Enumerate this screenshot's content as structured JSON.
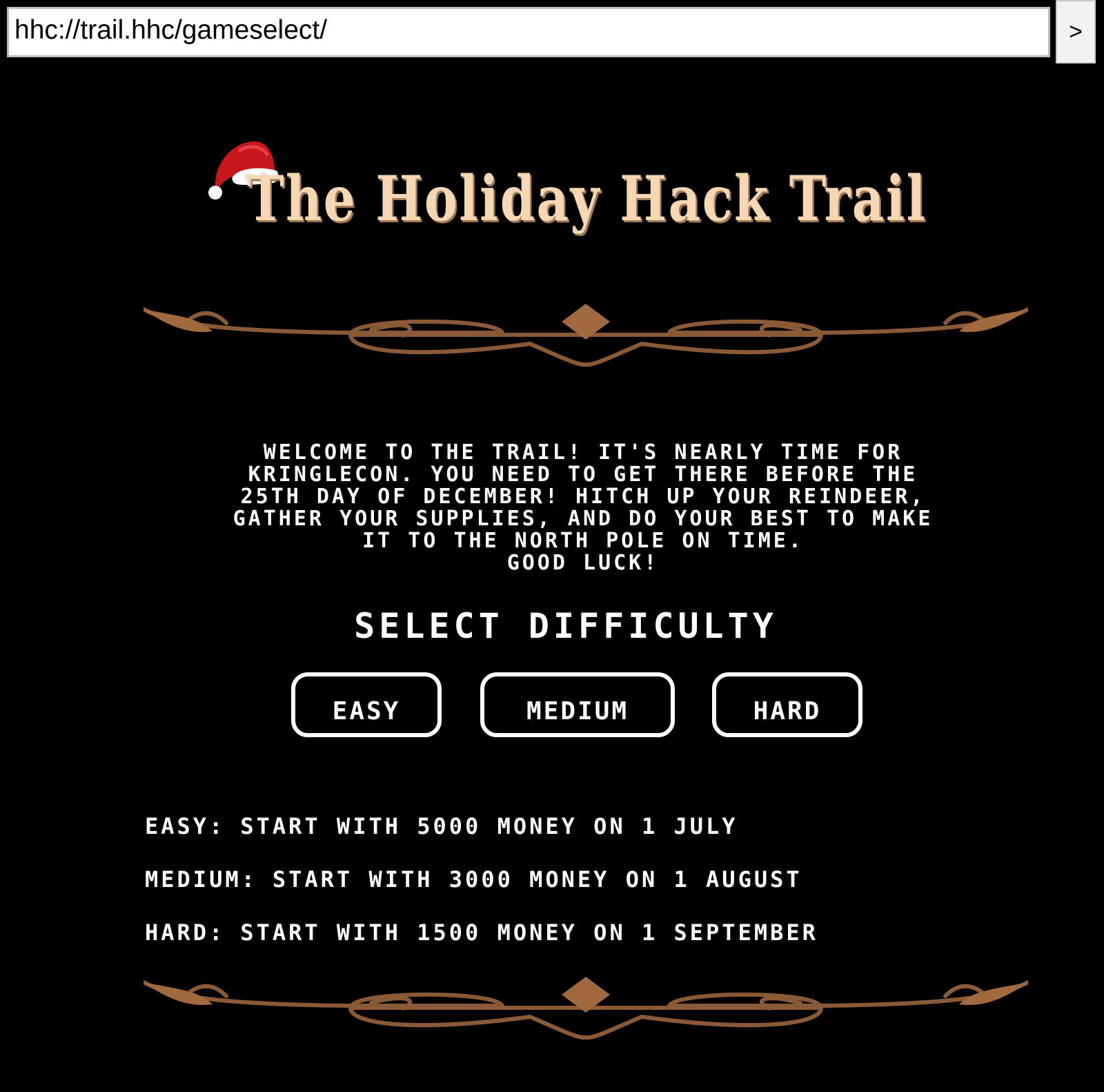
{
  "browser": {
    "url": "hhc://trail.hhc/gameselect/",
    "go_label": ">"
  },
  "header": {
    "title": "The Holiday Hack Trail",
    "hat_icon": "santa-hat-icon"
  },
  "intro": {
    "lines": [
      "WELCOME TO THE TRAIL! IT'S NEARLY TIME FOR",
      "KRINGLECON. YOU NEED TO GET THERE BEFORE THE",
      "25TH DAY OF DECEMBER! HITCH UP YOUR REINDEER,",
      "GATHER YOUR SUPPLIES, AND DO YOUR BEST TO MAKE",
      "IT TO THE NORTH POLE ON TIME.",
      "GOOD LUCK!"
    ]
  },
  "difficulty": {
    "heading": "SELECT DIFFICULTY",
    "buttons": {
      "easy": "EASY",
      "medium": "MEDIUM",
      "hard": "HARD"
    },
    "descriptions": {
      "easy": {
        "label": "EASY:",
        "text": "START WITH 5000 MONEY ON 1 JULY"
      },
      "medium": {
        "label": "MEDIUM:",
        "text": "START WITH 3000 MONEY ON 1 AUGUST"
      },
      "hard": {
        "label": "HARD:",
        "text": "START WITH 1500 MONEY ON 1 SEPTEMBER"
      }
    }
  },
  "colors": {
    "background": "#000000",
    "title": "#f6d7b3",
    "ornament": "#8a5a36",
    "hat_red": "#c8161d"
  }
}
